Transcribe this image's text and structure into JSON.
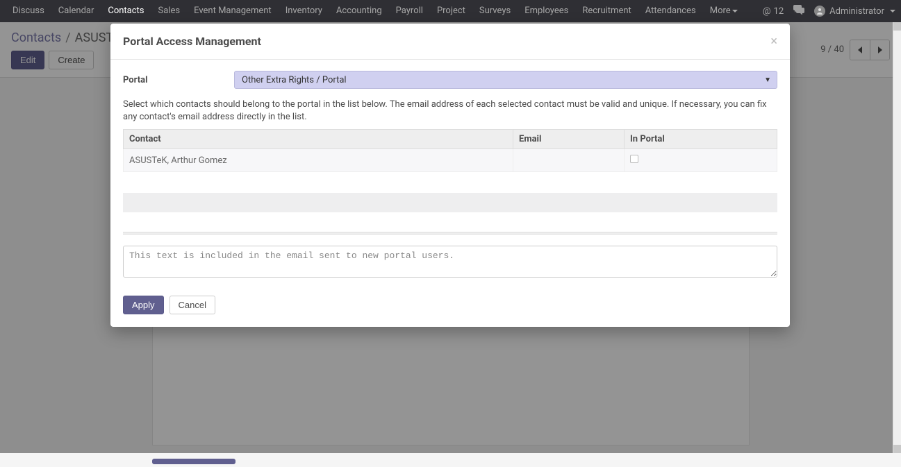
{
  "nav": {
    "items": [
      "Discuss",
      "Calendar",
      "Contacts",
      "Sales",
      "Event Management",
      "Inventory",
      "Accounting",
      "Payroll",
      "Project",
      "Surveys",
      "Employees",
      "Recruitment",
      "Attendances",
      "More"
    ],
    "active_index": 2,
    "mention_count": "12",
    "user_name": "Administrator"
  },
  "breadcrumb": {
    "root": "Contacts",
    "current": "ASUST"
  },
  "controls": {
    "edit_label": "Edit",
    "create_label": "Create",
    "pager_text": "9 / 40"
  },
  "modal": {
    "title": "Portal Access Management",
    "portal_label": "Portal",
    "portal_value": "Other Extra Rights / Portal",
    "help_text": "Select which contacts should belong to the portal in the list below. The email address of each selected contact must be valid and unique. If necessary, you can fix any contact's email address directly in the list.",
    "table": {
      "headers": {
        "contact": "Contact",
        "email": "Email",
        "in_portal": "In Portal"
      },
      "rows": [
        {
          "contact": "ASUSTeK, Arthur Gomez",
          "email": "",
          "in_portal": false
        }
      ]
    },
    "message_placeholder": "This text is included in the email sent to new portal users.",
    "apply_label": "Apply",
    "cancel_label": "Cancel"
  }
}
